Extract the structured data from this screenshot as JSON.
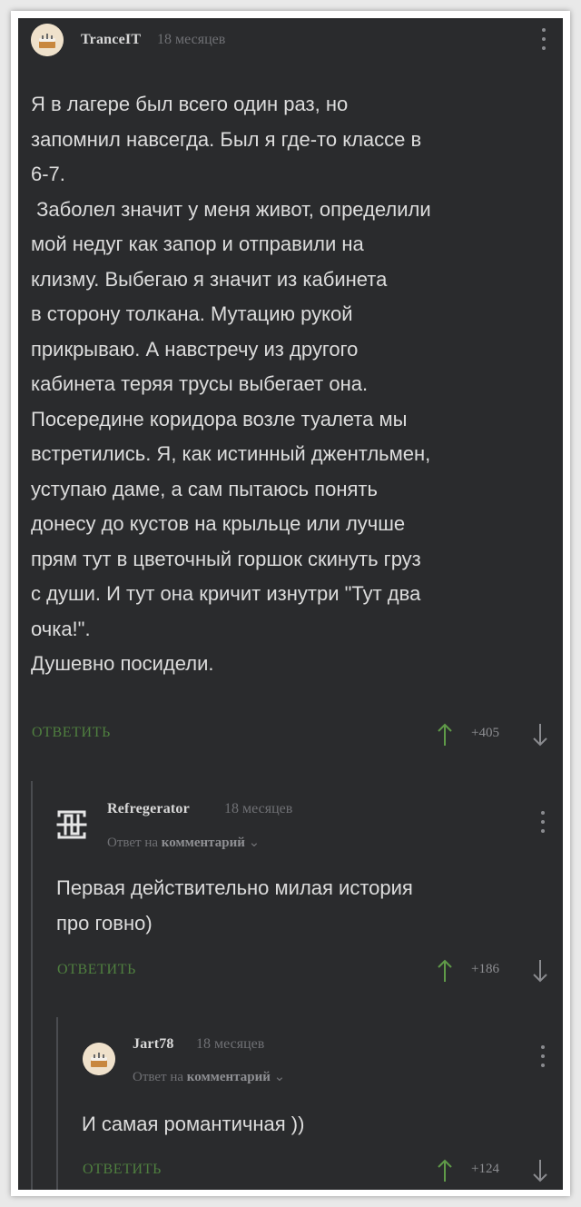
{
  "colors": {
    "background": "#2a2b2d",
    "text": "#dcdcdc",
    "muted": "#6f7074",
    "reply_green": "#4f7f3f",
    "upvote_green": "#5f9a48"
  },
  "comments": [
    {
      "author": "TranceIT",
      "time": "18 месяцев",
      "avatar_icon": "cake-avatar-icon",
      "text": "Я в лагере был всего один раз, но\nзапомнил навсегда. Был я где-то классе в\n6-7.\n Заболел значит у меня живот, определили\nмой недуг как запор и отправили на\nклизму. Выбегаю я значит из кабинета\nв сторону толкана. Мутацию рукой\nприкрываю. А навстречу из другого\nкабинета теряя трусы выбегает она.\nПосередине коридора возле туалета мы\nвстретились. Я, как истинный джентльмен,\nуступаю даме, а сам пытаюсь понять\nдонесу до кустов на крыльце или лучше\nпрям тут в цветочный горшок скинуть груз\nс души. И тут она кричит изнутри \"Тут два\nочка!\".\nДушевно посидели.",
      "reply_label": "ОТВЕТИТЬ",
      "rating": "+405"
    },
    {
      "author": "Refregerator",
      "time": "18 месяцев",
      "avatar_icon": "rammstein-logo-icon",
      "reply_to_prefix": "Ответ на",
      "reply_to_target": "комментарий",
      "text": "Первая действительно милая история\nпро говно)",
      "reply_label": "ОТВЕТИТЬ",
      "rating": "+186"
    },
    {
      "author": "Jart78",
      "time": "18 месяцев",
      "avatar_icon": "cake-avatar-icon",
      "reply_to_prefix": "Ответ на",
      "reply_to_target": "комментарий",
      "text": "И самая романтичная ))",
      "reply_label": "ОТВЕТИТЬ",
      "rating": "+124"
    }
  ]
}
